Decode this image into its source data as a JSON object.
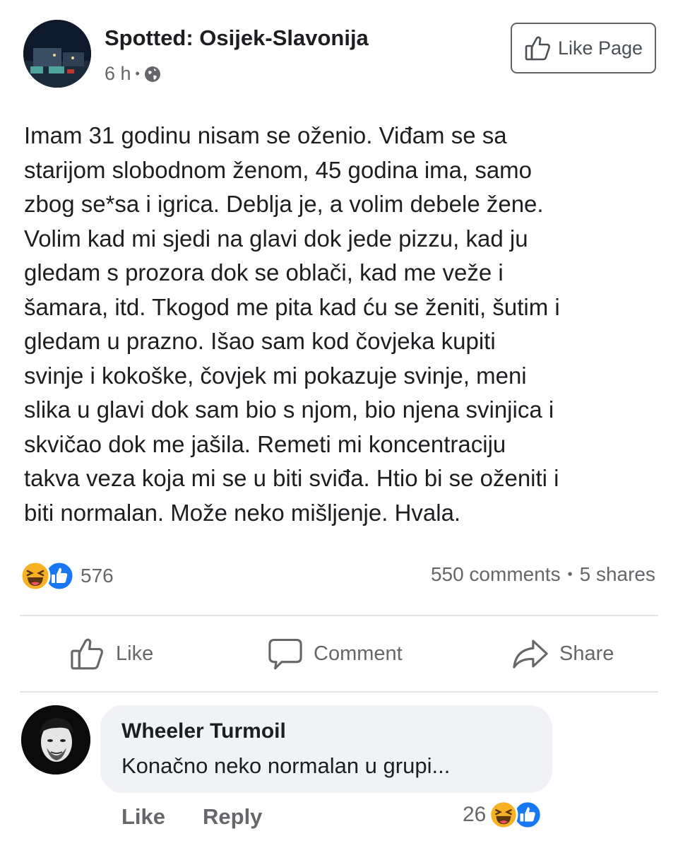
{
  "header": {
    "page_name": "Spotted: Osijek-Slavonija",
    "time": "6 h",
    "separator": "•",
    "like_page_label": "Like Page",
    "audience_icon": "globe-icon"
  },
  "post": {
    "text": "Imam 31 godinu nisam se oženio. Viđam se sa\nstarijom slobodnom ženom, 45 godina ima, samo\nzbog se*sa i igrica. Deblja je, a volim debele žene.\nVolim kad mi sjedi na glavi dok jede pizzu, kad ju\ngledam s prozora dok se oblači, kad me veže i\nšamara, itd. Tkogod me pita kad ću se ženiti, šutim i\ngledam u prazno. Išao sam kod čovjeka kupiti\nsvinje i kokoške, čovjek mi pokazuje svinje, meni\nslika u glavi dok sam bio s njom, bio njena svinjica i\nskvičao dok me jašila. Remeti mi koncentraciju\ntakva veza koja mi se u biti sviđa. Htio bi se oženiti i\nbiti normalan. Može neko mišljenje. Hvala."
  },
  "stats": {
    "reaction_count": "576",
    "reaction_icons": [
      "haha-icon",
      "like-icon"
    ],
    "comments": "550 comments",
    "dot": "•",
    "shares": "5 shares"
  },
  "actions": {
    "like": "Like",
    "comment": "Comment",
    "share": "Share"
  },
  "comment": {
    "author": "Wheeler Turmoil",
    "text": "Konačno neko normalan u grupi...",
    "like_label": "Like",
    "reply_label": "Reply",
    "reaction_count": "26"
  },
  "colors": {
    "text": "#1c1e21",
    "secondary": "#65676b",
    "divider": "#e4e6eb",
    "bubble": "#f0f2f5",
    "like_blue": "#1877f2",
    "haha_yellow": "#f7b125"
  }
}
